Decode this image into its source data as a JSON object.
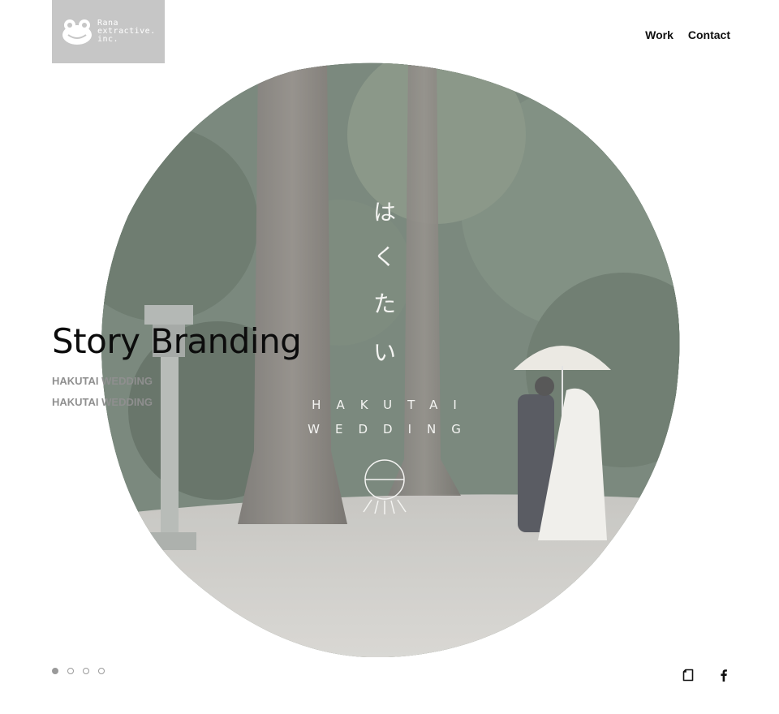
{
  "brand": {
    "logo_line1": "Rana",
    "logo_line2": "extractive.",
    "logo_line3": "inc."
  },
  "nav": {
    "items": [
      {
        "label": "Work"
      },
      {
        "label": "Contact"
      }
    ]
  },
  "hero": {
    "title": "Story Branding",
    "subtitles": [
      "HAKUTAI WEDDING",
      "HAKUTAI WEDDING"
    ],
    "image_text": {
      "vertical_jp": "はくたい",
      "line1": "HAKUTAI",
      "line2": "WEDDING"
    }
  },
  "pagination": {
    "total": 4,
    "active_index": 0
  },
  "social": {
    "icons": [
      "note-icon",
      "facebook-icon"
    ]
  },
  "colors": {
    "logo_bg": "#c6c6c6",
    "text": "#111111",
    "subtitle": "#8f8f8f",
    "dot": "#9a9a9a"
  }
}
